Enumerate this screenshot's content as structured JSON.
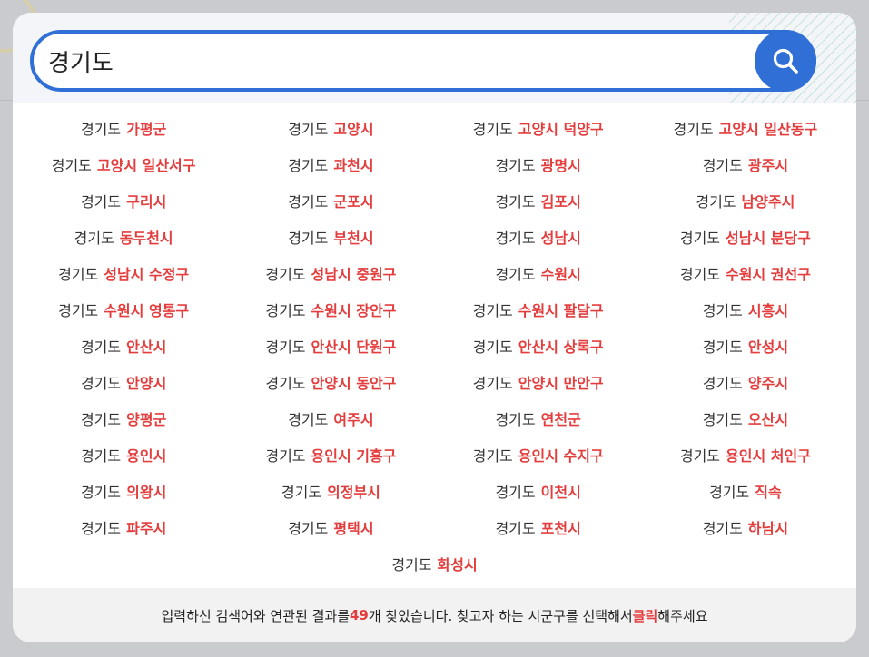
{
  "search": {
    "value": "경기도"
  },
  "results": [
    {
      "prov": "경기도",
      "city": "가평군"
    },
    {
      "prov": "경기도",
      "city": "고양시"
    },
    {
      "prov": "경기도",
      "city": "고양시 덕양구"
    },
    {
      "prov": "경기도",
      "city": "고양시 일산동구"
    },
    {
      "prov": "경기도",
      "city": "고양시 일산서구"
    },
    {
      "prov": "경기도",
      "city": "과천시"
    },
    {
      "prov": "경기도",
      "city": "광명시"
    },
    {
      "prov": "경기도",
      "city": "광주시"
    },
    {
      "prov": "경기도",
      "city": "구리시"
    },
    {
      "prov": "경기도",
      "city": "군포시"
    },
    {
      "prov": "경기도",
      "city": "김포시"
    },
    {
      "prov": "경기도",
      "city": "남양주시"
    },
    {
      "prov": "경기도",
      "city": "동두천시"
    },
    {
      "prov": "경기도",
      "city": "부천시"
    },
    {
      "prov": "경기도",
      "city": "성남시"
    },
    {
      "prov": "경기도",
      "city": "성남시 분당구"
    },
    {
      "prov": "경기도",
      "city": "성남시 수정구"
    },
    {
      "prov": "경기도",
      "city": "성남시 중원구"
    },
    {
      "prov": "경기도",
      "city": "수원시"
    },
    {
      "prov": "경기도",
      "city": "수원시 권선구"
    },
    {
      "prov": "경기도",
      "city": "수원시 영통구"
    },
    {
      "prov": "경기도",
      "city": "수원시 장안구"
    },
    {
      "prov": "경기도",
      "city": "수원시 팔달구"
    },
    {
      "prov": "경기도",
      "city": "시흥시"
    },
    {
      "prov": "경기도",
      "city": "안산시"
    },
    {
      "prov": "경기도",
      "city": "안산시 단원구"
    },
    {
      "prov": "경기도",
      "city": "안산시 상록구"
    },
    {
      "prov": "경기도",
      "city": "안성시"
    },
    {
      "prov": "경기도",
      "city": "안양시"
    },
    {
      "prov": "경기도",
      "city": "안양시 동안구"
    },
    {
      "prov": "경기도",
      "city": "안양시 만안구"
    },
    {
      "prov": "경기도",
      "city": "양주시"
    },
    {
      "prov": "경기도",
      "city": "양평군"
    },
    {
      "prov": "경기도",
      "city": "여주시"
    },
    {
      "prov": "경기도",
      "city": "연천군"
    },
    {
      "prov": "경기도",
      "city": "오산시"
    },
    {
      "prov": "경기도",
      "city": "용인시"
    },
    {
      "prov": "경기도",
      "city": "용인시 기흥구"
    },
    {
      "prov": "경기도",
      "city": "용인시 수지구"
    },
    {
      "prov": "경기도",
      "city": "용인시 처인구"
    },
    {
      "prov": "경기도",
      "city": "의왕시"
    },
    {
      "prov": "경기도",
      "city": "의정부시"
    },
    {
      "prov": "경기도",
      "city": "이천시"
    },
    {
      "prov": "경기도",
      "city": "직속"
    },
    {
      "prov": "경기도",
      "city": "파주시"
    },
    {
      "prov": "경기도",
      "city": "평택시"
    },
    {
      "prov": "경기도",
      "city": "포천시"
    },
    {
      "prov": "경기도",
      "city": "하남시"
    },
    {
      "prov": "경기도",
      "city": "화성시"
    }
  ],
  "footer": {
    "text_before_count": "입력하신 검색어와 연관된 결과를 ",
    "count": "49",
    "text_after_count": "개 찾았습니다. 찾고자 하는 시군구를 선택해서 ",
    "click_word": "클릭",
    "text_end": "해주세요"
  },
  "colors": {
    "accent": "#2f6fd6",
    "highlight": "#e43d3d"
  },
  "icons": {
    "search_button": "search-icon"
  }
}
